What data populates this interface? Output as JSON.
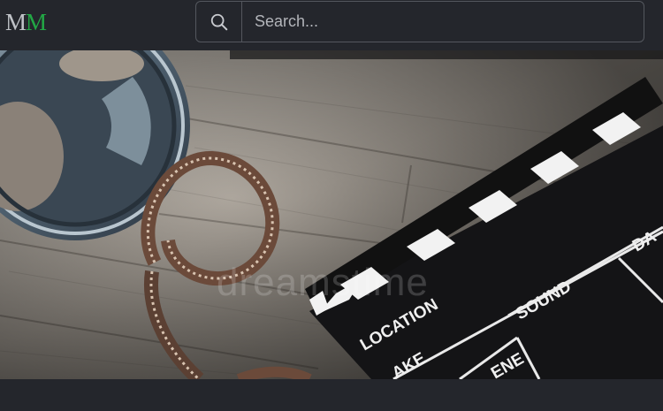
{
  "header": {
    "logo": {
      "letter1": "M",
      "letter2": "M",
      "color1": "#bfc2c7",
      "color2": "#22a745"
    },
    "search": {
      "placeholder": "Search...",
      "icon": "search-icon"
    }
  },
  "hero": {
    "description_icon": "film-reel-and-clapperboard-image",
    "watermark": "dreamstime",
    "clapperboard": {
      "label_location": "LOCATION",
      "label_sound": "SOUND",
      "label_date": "DA",
      "label_take": "AKE",
      "label_scene": "ENE"
    }
  }
}
